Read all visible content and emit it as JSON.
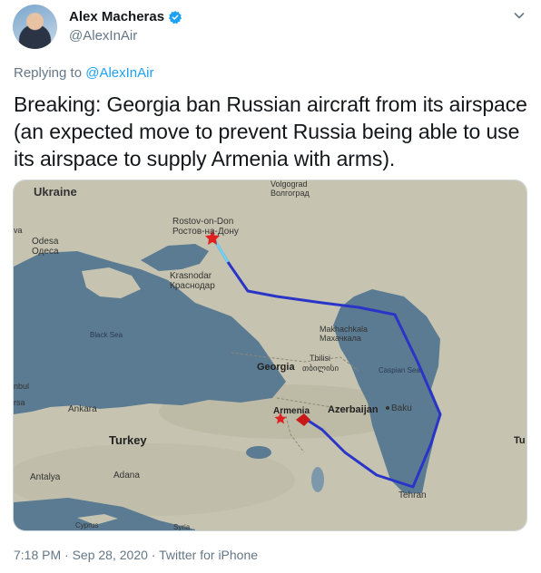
{
  "author": {
    "name": "Alex Macheras",
    "handle": "@AlexInAir",
    "verified": true
  },
  "reply": {
    "prefix": "Replying to ",
    "to": "@AlexInAir"
  },
  "tweet": {
    "text": "Breaking: Georgia ban Russian aircraft from its airspace (an expected move to prevent Russia being able to use its airspace to supply Armenia with arms)."
  },
  "map": {
    "labels": {
      "ukraine": "Ukraine",
      "volgograd": "Volgograd",
      "volgograd_ru": "Волгоград",
      "rostov": "Rostov-on-Don",
      "rostov_ru": "Ростов-на-Дону",
      "odesa": "Odesa",
      "odesa_ru": "Одеса",
      "krasnodar": "Krasnodar",
      "krasnodar_ru": "Краснодар",
      "black_sea": "Black Sea",
      "makhachkala": "Makhachkala",
      "makhachkala_ru": "Махачкала",
      "georgia": "Georgia",
      "tbilisi": "Tbilisi",
      "tbilisi_ka": "თბილისი",
      "caspian": "Caspian Sea",
      "armenia": "Armenia",
      "azerbaijan": "Azerbaijan",
      "baku": "Baku",
      "ankara": "Ankara",
      "turkey": "Turkey",
      "antalya": "Antalya",
      "adana": "Adana",
      "tehran": "Tehran",
      "cyprus": "Cyprus",
      "syria": "Syria",
      "edge_va": "va",
      "edge_nbul": "nbul",
      "edge_rsa": "rsa",
      "edge_tu": "Tu"
    },
    "colors": {
      "land": "#c9c7b4",
      "sea": "#5f7f95",
      "route": "#2a35c8"
    }
  },
  "meta": {
    "time": "7:18 PM",
    "separator": "·",
    "date": "Sep 28, 2020",
    "source": "Twitter for iPhone"
  }
}
